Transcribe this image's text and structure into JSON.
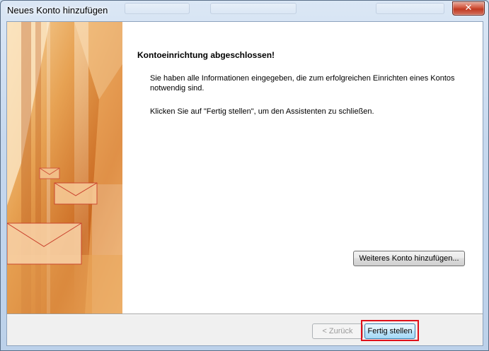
{
  "window": {
    "title": "Neues Konto hinzufügen",
    "accent_highlight": "#e0101a"
  },
  "titlebar": {
    "close_icon": "close-icon"
  },
  "main": {
    "heading": "Kontoeinrichtung abgeschlossen!",
    "paragraph1": "Sie haben alle Informationen eingegeben, die zum erfolgreichen Einrichten eines Kontos notwendig sind.",
    "paragraph2": "Klicken Sie auf \"Fertig stellen\", um den Assistenten zu schließen.",
    "add_account_label": "Weiteres Konto hinzufügen..."
  },
  "footer": {
    "back_label": "< Zurück",
    "finish_label": "Fertig stellen"
  },
  "art": {
    "description_icon": "envelope-icon",
    "colors": [
      "#c0601a",
      "#e29a45",
      "#f6d6a6"
    ]
  }
}
